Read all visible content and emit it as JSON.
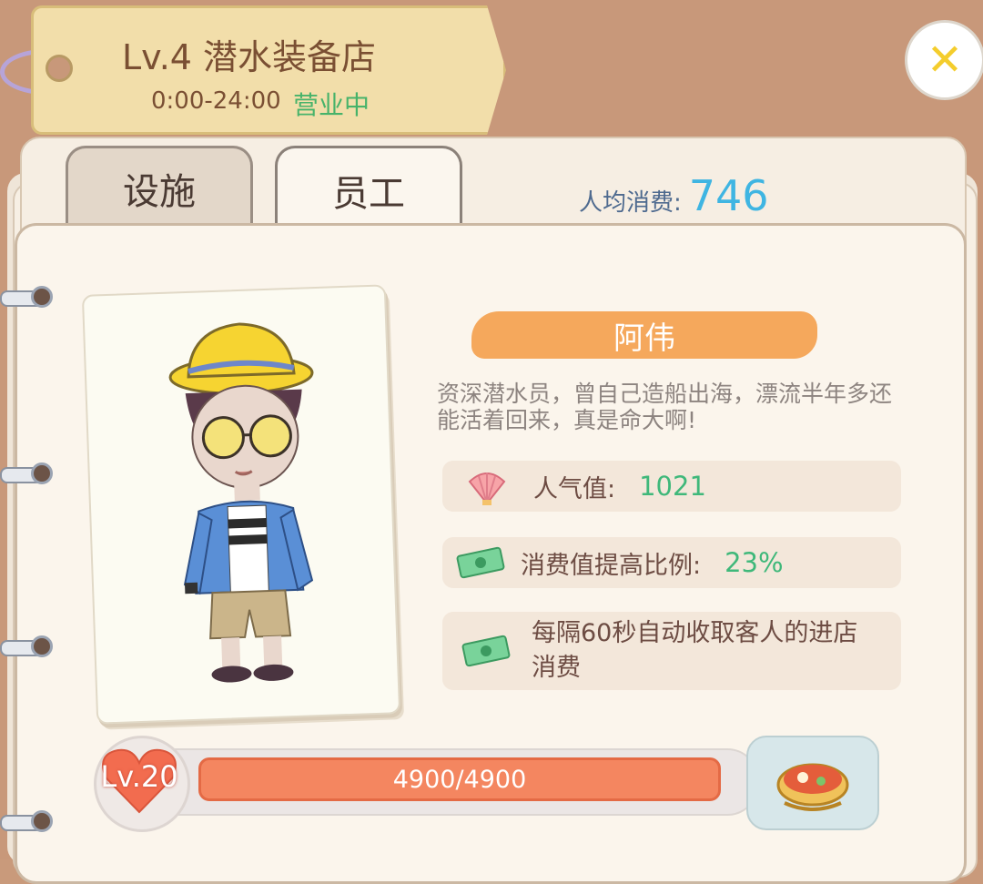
{
  "shop": {
    "title": "Lv.4 潜水装备店",
    "hours": "0:00-24:00",
    "status": "营业中"
  },
  "tabs": [
    {
      "label": "设施",
      "active": false
    },
    {
      "label": "员工",
      "active": true
    }
  ],
  "avg_spend": {
    "label": "人均消费:",
    "value": "746"
  },
  "employee": {
    "name": "阿伟",
    "description": "资深潜水员，曾自己造船出海，漂流半年多还能活着回来，真是命大啊!",
    "stats": [
      {
        "icon": "seashell-icon",
        "label": "人气值:",
        "value": "1021"
      },
      {
        "icon": "money-icon",
        "label": "消费值提高比例:",
        "value": "23%"
      },
      {
        "icon": "money-icon",
        "label": "每隔60秒自动收取客人的进店消费",
        "value": ""
      }
    ],
    "level": "Lv.20",
    "exp_text": "4900/4900",
    "exp_fraction": 1.0
  },
  "reward": {
    "icon": "hotpot-icon"
  },
  "colors": {
    "accent_green": "#3fb87a",
    "avg_value_blue": "#3fb5e2",
    "name_banner": "#f5a85c",
    "exp_bar": "#f48660",
    "heart": "#f26c4f"
  }
}
